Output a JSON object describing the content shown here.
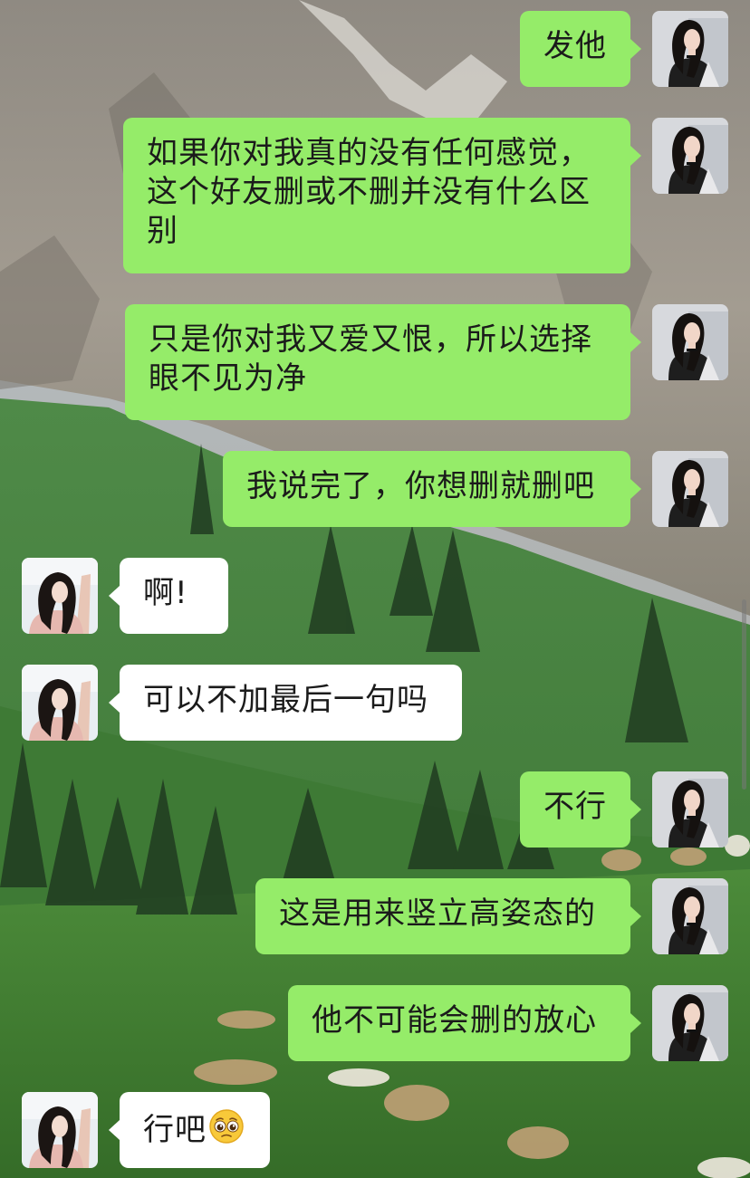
{
  "chat": {
    "messages": [
      {
        "side": "right",
        "text": "发他"
      },
      {
        "side": "right",
        "text": "如果你对我真的没有任何感觉，这个好友删或不删并没有什么区别"
      },
      {
        "side": "right",
        "text": "只是你对我又爱又恨，所以选择眼不见为净"
      },
      {
        "side": "right",
        "text": "我说完了，你想删就删吧"
      },
      {
        "side": "left",
        "text": "啊!"
      },
      {
        "side": "left",
        "text": "可以不加最后一句吗"
      },
      {
        "side": "right",
        "text": "不行"
      },
      {
        "side": "right",
        "text": "这是用来竖立高姿态的"
      },
      {
        "side": "right",
        "text": "他不可能会删的放心"
      },
      {
        "side": "left",
        "text": "行吧",
        "emoji": "pleading-face-emoji"
      }
    ]
  },
  "theme": {
    "right_bubble_color": "#95ec69",
    "left_bubble_color": "#ffffff"
  }
}
